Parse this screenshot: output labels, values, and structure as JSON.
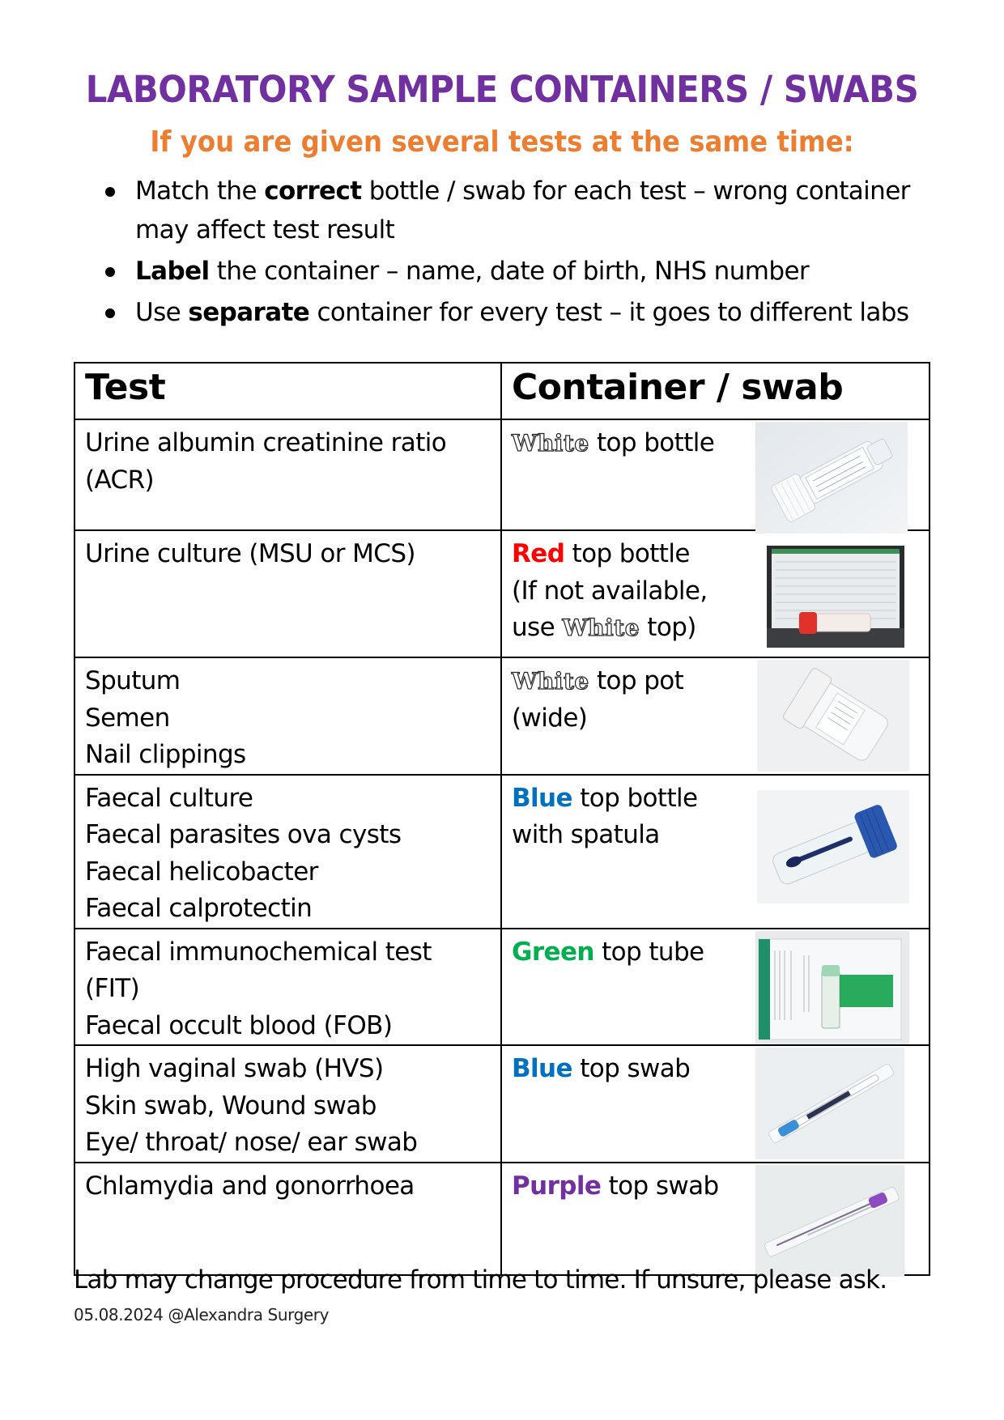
{
  "title": "LABORATORY SAMPLE CONTAINERS / SWABS",
  "subtitle": "If you are given several tests at the same time:",
  "bullets": [
    {
      "before": "Match the ",
      "bold": "correct",
      "after": " bottle / swab for each test – wrong container may affect test result"
    },
    {
      "before": "",
      "bold": "Label",
      "after": " the container – name, date of birth, NHS number"
    },
    {
      "before": "Use ",
      "bold": "separate",
      "after": " container for every test – it goes to different labs"
    }
  ],
  "table": {
    "headers": {
      "test": "Test",
      "container": "Container / swab"
    },
    "rows": [
      {
        "tests": [
          "Urine albumin creatinine ratio",
          "(ACR)"
        ],
        "container": {
          "color_word": "White",
          "color": "#FFFFFF",
          "rest": " top bottle",
          "extra_lines": []
        },
        "photo": "white-top-bottle-photo"
      },
      {
        "tests": [
          "Urine culture (MSU or MCS)"
        ],
        "container": {
          "color_word": "Red",
          "color": "#FF0000",
          "rest": " top bottle",
          "extra_lines": [
            "(If not available,"
          ],
          "last_line_before": "use ",
          "last_line_white": "White",
          "last_line_after": " top)"
        },
        "photo": "red-top-bottle-photo"
      },
      {
        "tests": [
          "Sputum",
          "Semen",
          "Nail clippings"
        ],
        "container": {
          "color_word": "White",
          "color": "#FFFFFF",
          "rest": " top pot",
          "extra_lines": [
            "(wide)"
          ]
        },
        "photo": "white-top-pot-photo"
      },
      {
        "tests": [
          "Faecal culture",
          "Faecal parasites ova cysts",
          "Faecal helicobacter",
          "Faecal calprotectin"
        ],
        "container": {
          "color_word": "Blue",
          "color": "#0070C0",
          "rest": " top bottle",
          "extra_lines": [
            "with spatula"
          ]
        },
        "photo": "blue-top-bottle-photo"
      },
      {
        "tests": [
          "Faecal immunochemical test",
          "(FIT)",
          "Faecal occult blood (FOB)"
        ],
        "container": {
          "color_word": "Green",
          "color": "#00B050",
          "rest": " top tube",
          "extra_lines": []
        },
        "photo": "green-top-tube-photo"
      },
      {
        "tests": [
          "High vaginal swab (HVS)",
          "Skin swab, Wound swab",
          "Eye/ throat/ nose/ ear swab"
        ],
        "container": {
          "color_word": "Blue",
          "color": "#0070C0",
          "rest": " top swab",
          "extra_lines": []
        },
        "photo": "blue-top-swab-photo"
      },
      {
        "tests": [
          "Chlamydia and gonorrhoea"
        ],
        "container": {
          "color_word": "Purple",
          "color": "#7030A0",
          "rest": " top swab",
          "extra_lines": []
        },
        "photo": "purple-top-swab-photo"
      }
    ]
  },
  "footer": {
    "note": "Lab may change procedure from time to time. If unsure, please ask.",
    "date_credit": "05.08.2024 @Alexandra Surgery"
  },
  "colors": {
    "title": "#7030A0",
    "subtitle": "#ED7D31",
    "red": "#FF0000",
    "blue": "#0070C0",
    "green": "#00B050",
    "purple": "#7030A0"
  }
}
